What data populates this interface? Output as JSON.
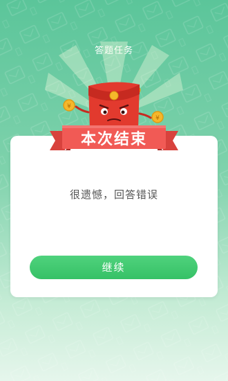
{
  "header": {
    "title": "答题任务"
  },
  "result": {
    "banner_text": "本次结束",
    "message": "很遗憾，回答错误"
  },
  "actions": {
    "continue_label": "继续"
  },
  "mascot": {
    "coin_symbol": "¥"
  },
  "colors": {
    "background_top": "#5bc59a",
    "background_bottom": "#e6f6ec",
    "ribbon": "#f15a55",
    "envelope": "#e23a2e",
    "button": "#3ec86f",
    "coin": "#f5b72b"
  },
  "icons": [
    "red-envelope-icon",
    "coin-icon",
    "ribbon-banner-icon"
  ]
}
